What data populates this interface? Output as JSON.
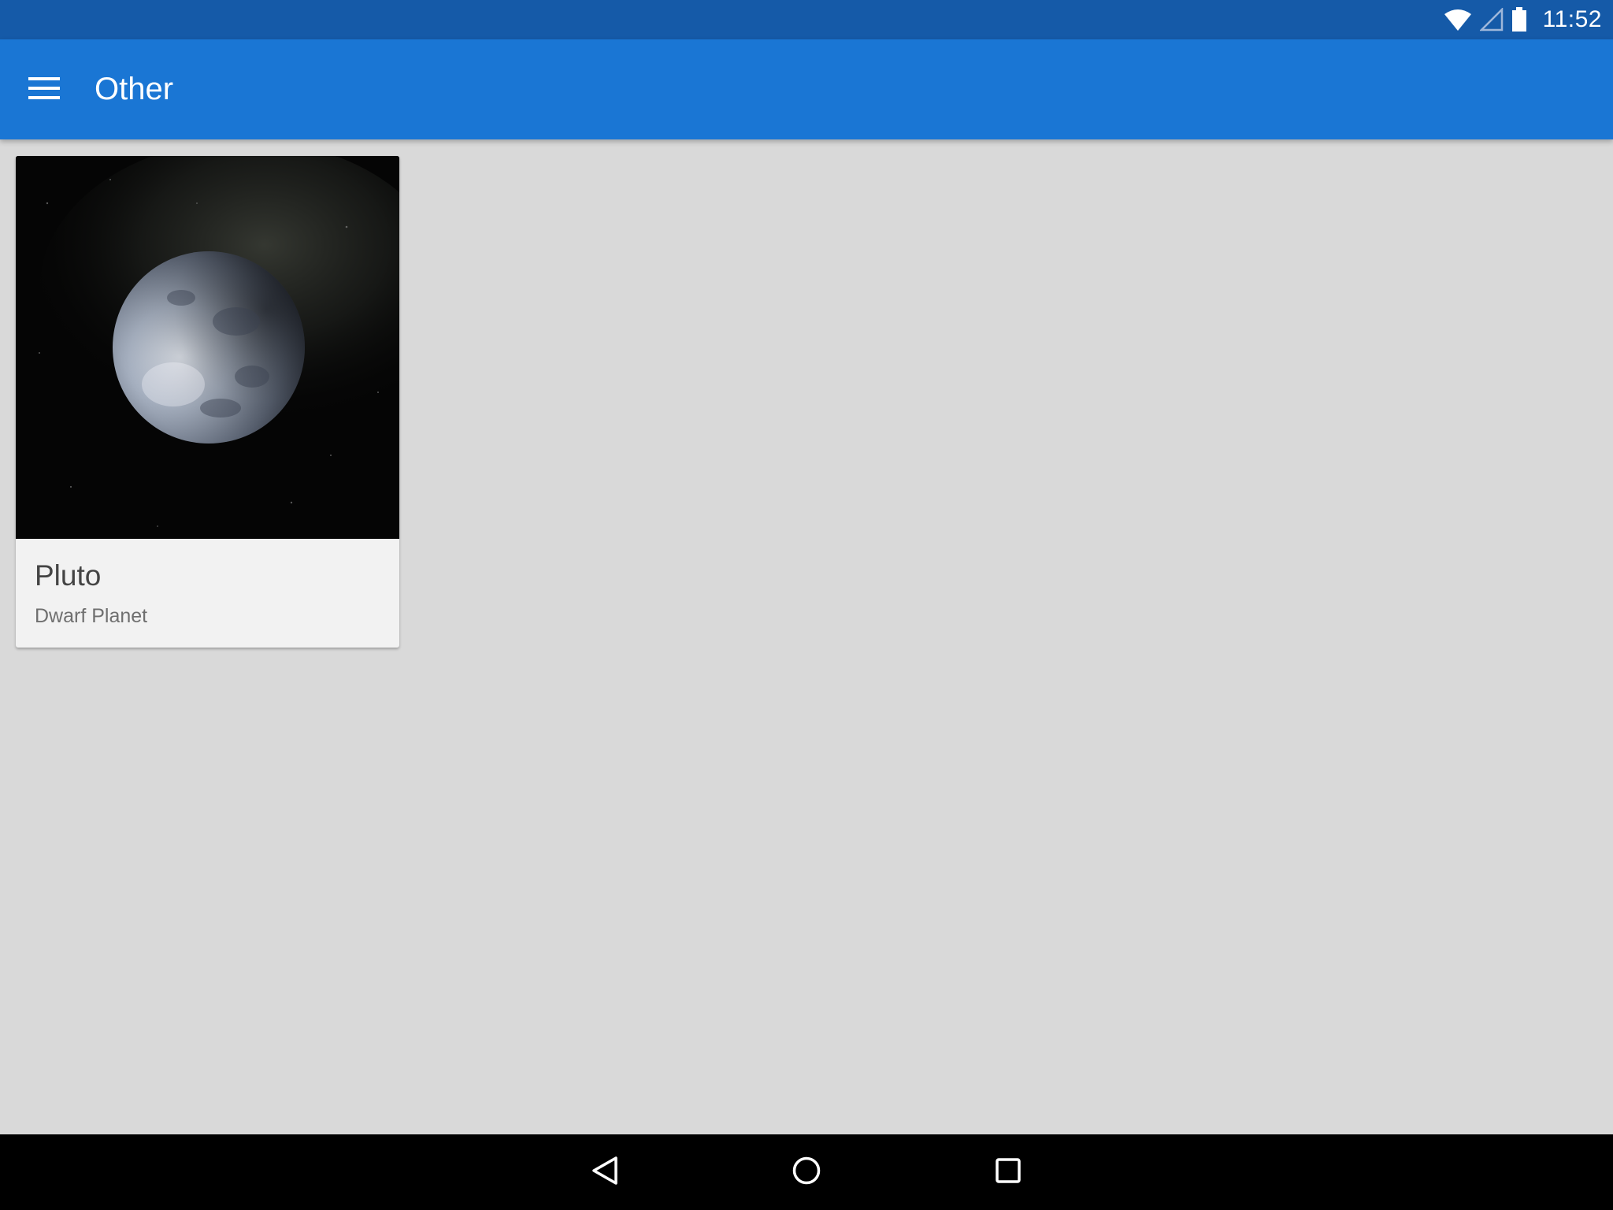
{
  "status_bar": {
    "time": "11:52",
    "icons": [
      "wifi-icon",
      "cell-signal-icon",
      "battery-icon"
    ],
    "color": "#155aa8"
  },
  "app_bar": {
    "title": "Other",
    "menu_icon": "hamburger-menu-icon",
    "color": "#1a76d4"
  },
  "cards": [
    {
      "title": "Pluto",
      "subtitle": "Dwarf Planet",
      "image": "pluto-image"
    }
  ],
  "nav_bar": {
    "buttons": [
      "back-icon",
      "home-icon",
      "recents-icon"
    ]
  }
}
